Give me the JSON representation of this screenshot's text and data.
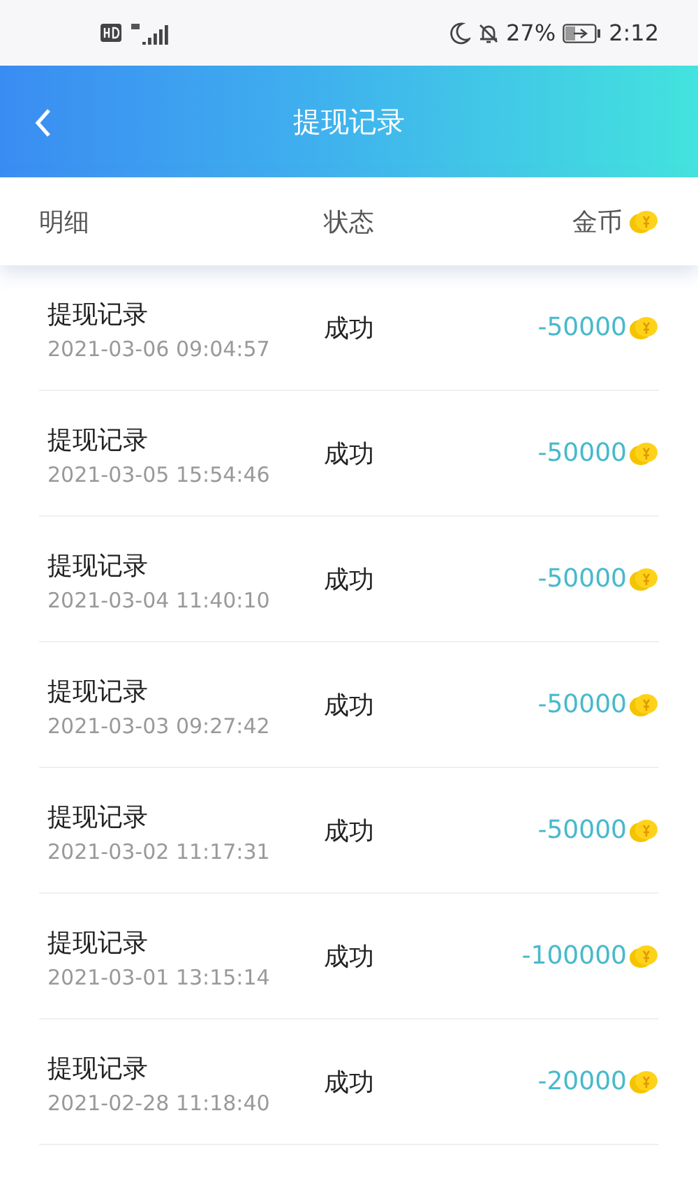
{
  "status_bar": {
    "battery": "27%",
    "time": "2:12"
  },
  "header": {
    "title": "提现记录"
  },
  "columns": [
    "明细",
    "状态",
    "金币"
  ],
  "records": [
    {
      "title": "提现记录",
      "time": "2021-03-06 09:04:57",
      "status": "成功",
      "amount": "-50000"
    },
    {
      "title": "提现记录",
      "time": "2021-03-05 15:54:46",
      "status": "成功",
      "amount": "-50000"
    },
    {
      "title": "提现记录",
      "time": "2021-03-04 11:40:10",
      "status": "成功",
      "amount": "-50000"
    },
    {
      "title": "提现记录",
      "time": "2021-03-03 09:27:42",
      "status": "成功",
      "amount": "-50000"
    },
    {
      "title": "提现记录",
      "time": "2021-03-02 11:17:31",
      "status": "成功",
      "amount": "-50000"
    },
    {
      "title": "提现记录",
      "time": "2021-03-01 13:15:14",
      "status": "成功",
      "amount": "-100000"
    },
    {
      "title": "提现记录",
      "time": "2021-02-28 11:18:40",
      "status": "成功",
      "amount": "-20000"
    }
  ]
}
